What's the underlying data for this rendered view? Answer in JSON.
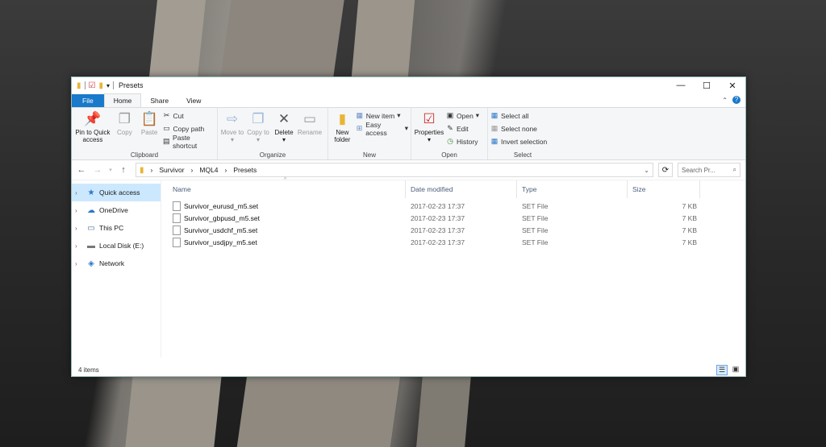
{
  "window": {
    "title": "Presets"
  },
  "tabs": [
    "File",
    "Home",
    "Share",
    "View"
  ],
  "clipboard": {
    "pin": "Pin to Quick access",
    "copy": "Copy",
    "paste": "Paste",
    "cut": "Cut",
    "copy_path": "Copy path",
    "paste_shortcut": "Paste shortcut",
    "label": "Clipboard"
  },
  "organize": {
    "move_to": "Move to",
    "copy_to": "Copy to",
    "delete": "Delete",
    "rename": "Rename",
    "label": "Organize"
  },
  "new_group": {
    "new_folder": "New folder",
    "new_item": "New item",
    "easy_access": "Easy access",
    "label": "New"
  },
  "open_group": {
    "properties": "Properties",
    "open": "Open",
    "edit": "Edit",
    "history": "History",
    "label": "Open"
  },
  "select_group": {
    "select_all": "Select all",
    "select_none": "Select none",
    "invert": "Invert selection",
    "label": "Select"
  },
  "address": {
    "path": [
      "Survivor",
      "MQL4",
      "Presets"
    ],
    "search_placeholder": "Search Pr..."
  },
  "navpane": [
    "Quick access",
    "OneDrive",
    "This PC",
    "Local Disk (E:)",
    "Network"
  ],
  "columns": [
    "Name",
    "Date modified",
    "Type",
    "Size"
  ],
  "files": [
    {
      "name": "Survivor_eurusd_m5.set",
      "date": "2017-02-23 17:37",
      "type": "SET File",
      "size": "7 KB"
    },
    {
      "name": "Survivor_gbpusd_m5.set",
      "date": "2017-02-23 17:37",
      "type": "SET File",
      "size": "7 KB"
    },
    {
      "name": "Survivor_usdchf_m5.set",
      "date": "2017-02-23 17:37",
      "type": "SET File",
      "size": "7 KB"
    },
    {
      "name": "Survivor_usdjpy_m5.set",
      "date": "2017-02-23 17:37",
      "type": "SET File",
      "size": "7 KB"
    }
  ],
  "status": {
    "count": "4 items"
  }
}
